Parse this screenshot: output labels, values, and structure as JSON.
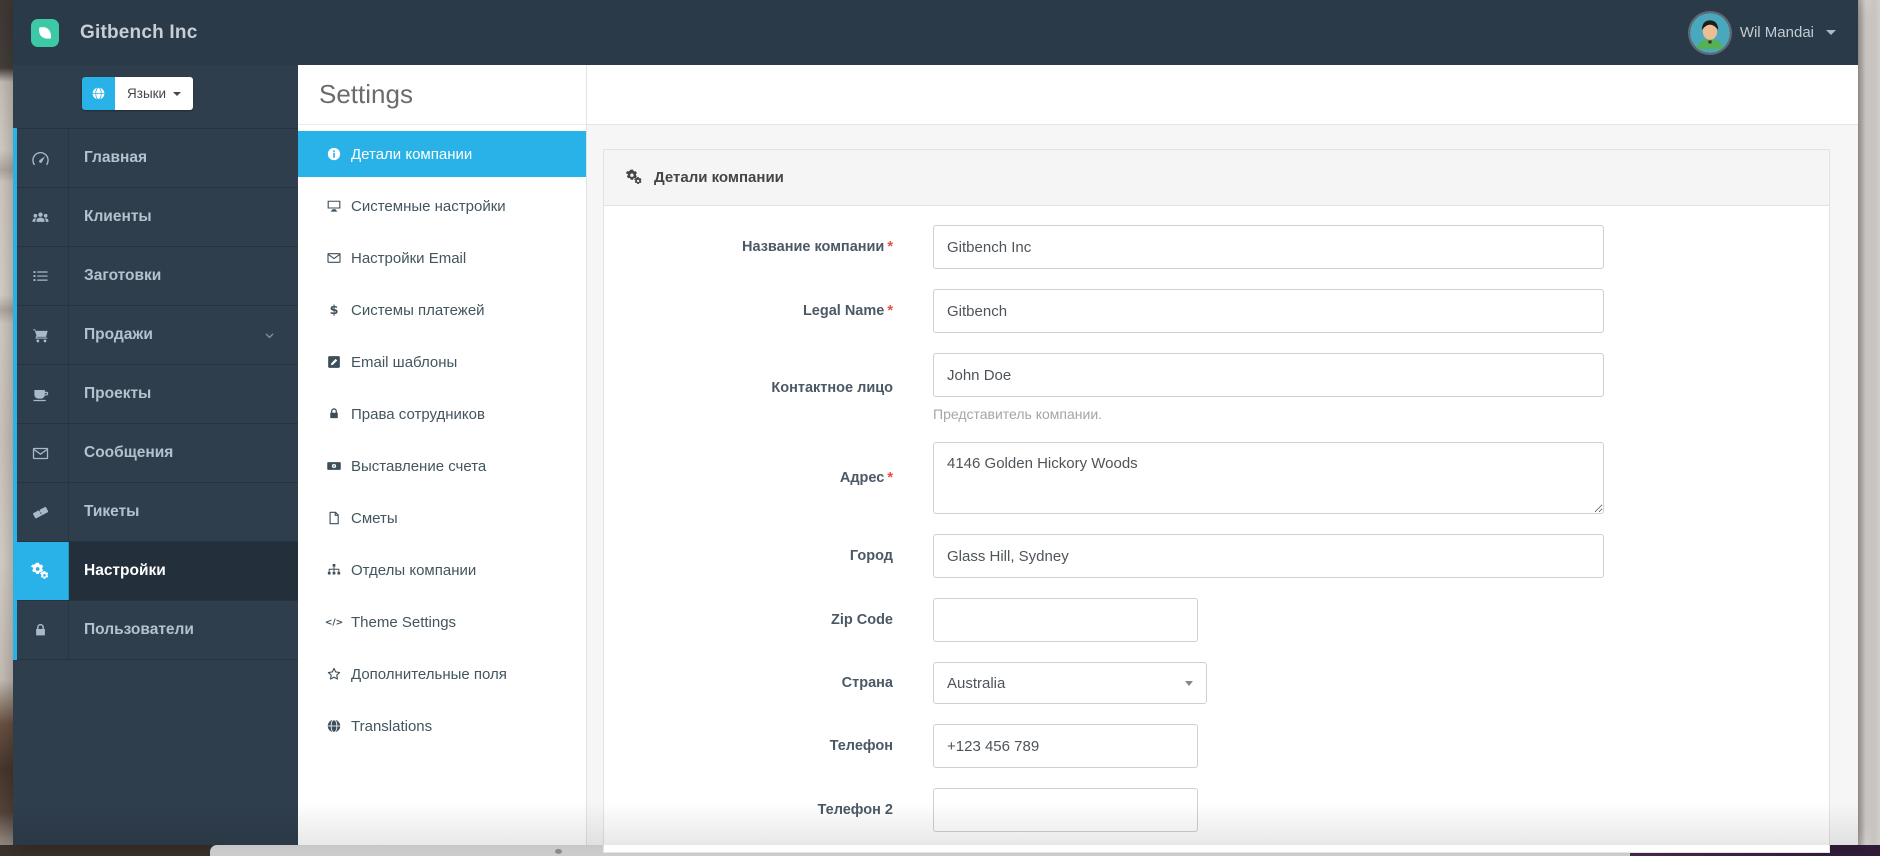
{
  "app": {
    "brand": "Gitbench Inc",
    "user_name": "Wil Mandai"
  },
  "colors": {
    "accent_blue": "#29b2e8",
    "brand_teal": "#3ec9a6",
    "navbar": "#2b3a48",
    "sidebar": "#2f3e4d",
    "required_red": "#e74c3c"
  },
  "sidebar": {
    "language_button": {
      "label": "Языки",
      "icon": "globe"
    },
    "items": [
      {
        "slug": "dashboard",
        "label": "Главная",
        "icon": "dashboard"
      },
      {
        "slug": "clients",
        "label": "Клиенты",
        "icon": "users"
      },
      {
        "slug": "templates",
        "label": "Заготовки",
        "icon": "list"
      },
      {
        "slug": "sales",
        "label": "Продажи",
        "icon": "cart",
        "has_submenu": true
      },
      {
        "slug": "projects",
        "label": "Проекты",
        "icon": "coffee"
      },
      {
        "slug": "messages",
        "label": "Сообщения",
        "icon": "envelope"
      },
      {
        "slug": "tickets",
        "label": "Тикеты",
        "icon": "ticket"
      },
      {
        "slug": "settings",
        "label": "Настройки",
        "icon": "cogs",
        "active": true
      },
      {
        "slug": "users",
        "label": "Пользователи",
        "icon": "lock"
      }
    ]
  },
  "settings_menu": {
    "title": "Settings",
    "items": [
      {
        "slug": "company-details",
        "label": "Детали компании",
        "icon": "info",
        "active": true
      },
      {
        "slug": "system-settings",
        "label": "Системные настройки",
        "icon": "desktop"
      },
      {
        "slug": "email-settings",
        "label": "Настройки Email",
        "icon": "envelope"
      },
      {
        "slug": "payment-systems",
        "label": "Системы платежей",
        "icon": "dollar"
      },
      {
        "slug": "email-templates",
        "label": "Email шаблоны",
        "icon": "pencil-square"
      },
      {
        "slug": "staff-permissions",
        "label": "Права сотрудников",
        "icon": "lock"
      },
      {
        "slug": "invoicing",
        "label": "Выставление счета",
        "icon": "money"
      },
      {
        "slug": "estimates",
        "label": "Сметы",
        "icon": "file"
      },
      {
        "slug": "company-departments",
        "label": "Отделы компании",
        "icon": "sitemap"
      },
      {
        "slug": "theme-settings",
        "label": "Theme Settings",
        "icon": "code"
      },
      {
        "slug": "custom-fields",
        "label": "Дополнительные поля",
        "icon": "star"
      },
      {
        "slug": "translations",
        "label": "Translations",
        "icon": "globe"
      }
    ]
  },
  "form": {
    "title": "Детали компании",
    "title_icon": "cogs",
    "required_marker": "*",
    "fields": [
      {
        "slug": "company-name",
        "label": "Название компании",
        "required": true,
        "type": "text",
        "value": "Gitbench Inc",
        "size": "full"
      },
      {
        "slug": "legal-name",
        "label": "Legal Name",
        "required": true,
        "type": "text",
        "value": "Gitbench",
        "size": "full"
      },
      {
        "slug": "contact-person",
        "label": "Контактное лицо",
        "required": false,
        "type": "text",
        "value": "John Doe",
        "size": "full",
        "help": "Представитель компании."
      },
      {
        "slug": "address",
        "label": "Адрес",
        "required": true,
        "type": "textarea",
        "value": "4146 Golden Hickory Woods",
        "size": "full"
      },
      {
        "slug": "city",
        "label": "Город",
        "required": false,
        "type": "text",
        "value": "Glass Hill, Sydney",
        "size": "full"
      },
      {
        "slug": "zip-code",
        "label": "Zip Code",
        "required": false,
        "type": "text",
        "value": "",
        "size": "small"
      },
      {
        "slug": "country",
        "label": "Страна",
        "required": false,
        "type": "select",
        "value": "Australia",
        "size": "small"
      },
      {
        "slug": "phone",
        "label": "Телефон",
        "required": false,
        "type": "text",
        "value": "+123 456 789",
        "size": "small"
      },
      {
        "slug": "phone2",
        "label": "Телефон 2",
        "required": false,
        "type": "text",
        "value": "",
        "size": "small"
      }
    ]
  }
}
